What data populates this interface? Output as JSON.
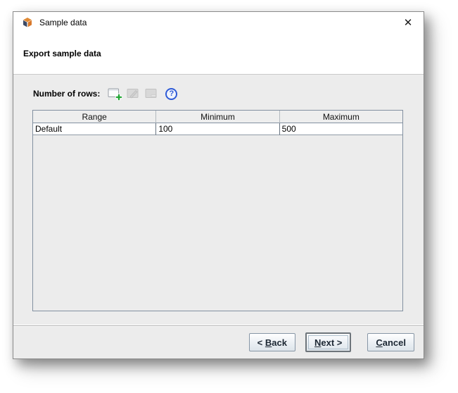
{
  "window": {
    "title": "Sample data",
    "close_glyph": "✕"
  },
  "page": {
    "heading": "Export sample data"
  },
  "toolbar": {
    "label": "Number of rows:",
    "help_glyph": "?",
    "buttons": [
      {
        "name": "add-range",
        "icon": "table-add-icon",
        "enabled": true
      },
      {
        "name": "edit-range",
        "icon": "table-edit-icon",
        "enabled": false
      },
      {
        "name": "remove-range",
        "icon": "table-remove-icon",
        "enabled": false
      },
      {
        "name": "help",
        "icon": "help-icon",
        "enabled": true
      }
    ]
  },
  "table": {
    "columns": [
      "Range",
      "Minimum",
      "Maximum"
    ],
    "rows": [
      {
        "range": "Default",
        "minimum": "100",
        "maximum": "500"
      }
    ]
  },
  "buttons": {
    "back": {
      "pre": "< ",
      "mnemonic": "B",
      "post": "ack"
    },
    "next": {
      "pre": "",
      "mnemonic": "N",
      "post": "ext >"
    },
    "cancel": {
      "pre": "",
      "mnemonic": "C",
      "post": "ancel"
    }
  },
  "colors": {
    "panel_bg": "#ececec",
    "add_accent": "#22a534",
    "help_accent": "#2f5bd7",
    "button_border": "#8796a6",
    "table_border": "#8290a0"
  }
}
